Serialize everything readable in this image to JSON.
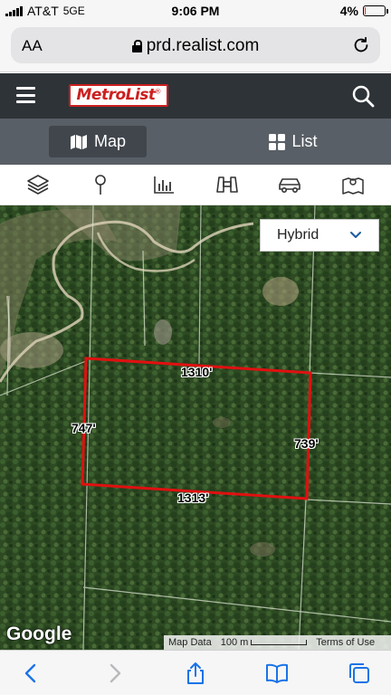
{
  "status_bar": {
    "carrier": "AT&T",
    "network": "5GE",
    "time": "9:06 PM",
    "battery_percent": "4%",
    "battery_level": 0.04
  },
  "browser": {
    "text_size_label": "AA",
    "url": "prd.realist.com"
  },
  "header": {
    "logo_text": "MetroList",
    "logo_mark": "®"
  },
  "view_toggle": {
    "map_label": "Map",
    "list_label": "List",
    "active": "Map"
  },
  "toolbar": {
    "icons": [
      "layers-icon",
      "map-pin-icon",
      "bar-chart-icon",
      "binoculars-icon",
      "car-icon",
      "map-location-icon"
    ]
  },
  "map": {
    "map_type_selected": "Hybrid",
    "parcel_dimensions": {
      "top": "1310'",
      "left": "747'",
      "right": "739'",
      "bottom": "1313'"
    },
    "parcel_outline_color": "#e01010",
    "google_logo": "Google",
    "attribution": {
      "map_data": "Map Data",
      "scale": "100 m",
      "terms": "Terms of Use"
    }
  },
  "bottom_nav": {
    "icons": [
      "back-icon",
      "forward-icon",
      "share-icon",
      "bookmarks-icon",
      "tabs-icon"
    ]
  }
}
